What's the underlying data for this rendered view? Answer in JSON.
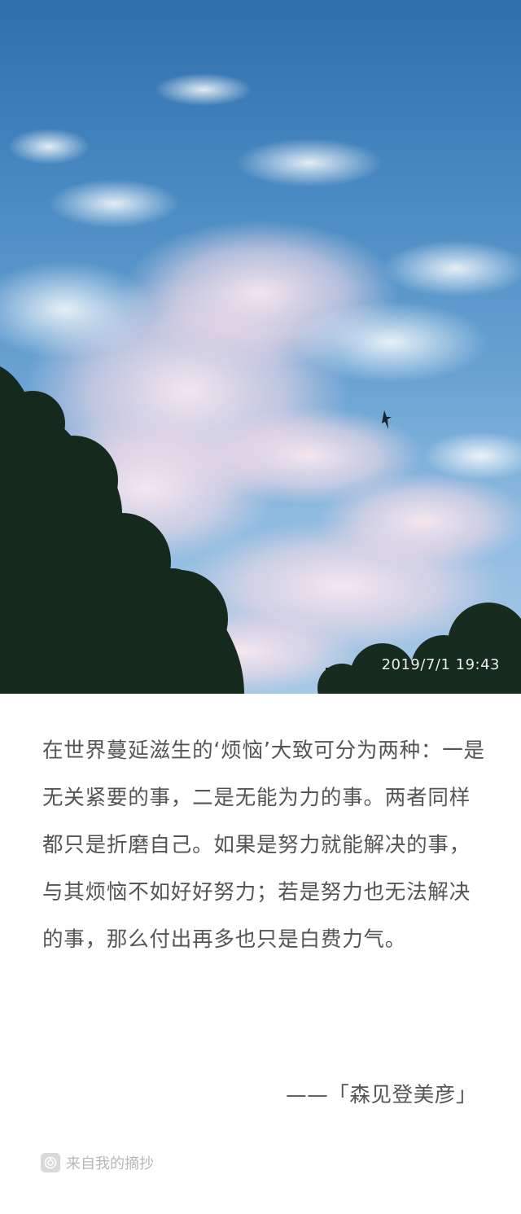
{
  "photo": {
    "timestamp": "2019/7/1 19:43",
    "description_icon": "sky-photo"
  },
  "quote": {
    "text": "在世界蔓延滋生的‘烦恼’大致可分为两种：一是无关紧要的事，二是无能为力的事。两者同样都只是折磨自己。如果是努力就能解决的事，与其烦恼不如好好努力；若是努力也无法解决的事，那么付出再多也只是白费力气。"
  },
  "author": {
    "attribution": "——「森见登美彦」"
  },
  "footer": {
    "source_label": "来自我的摘抄",
    "icon": "app-logo-icon"
  }
}
